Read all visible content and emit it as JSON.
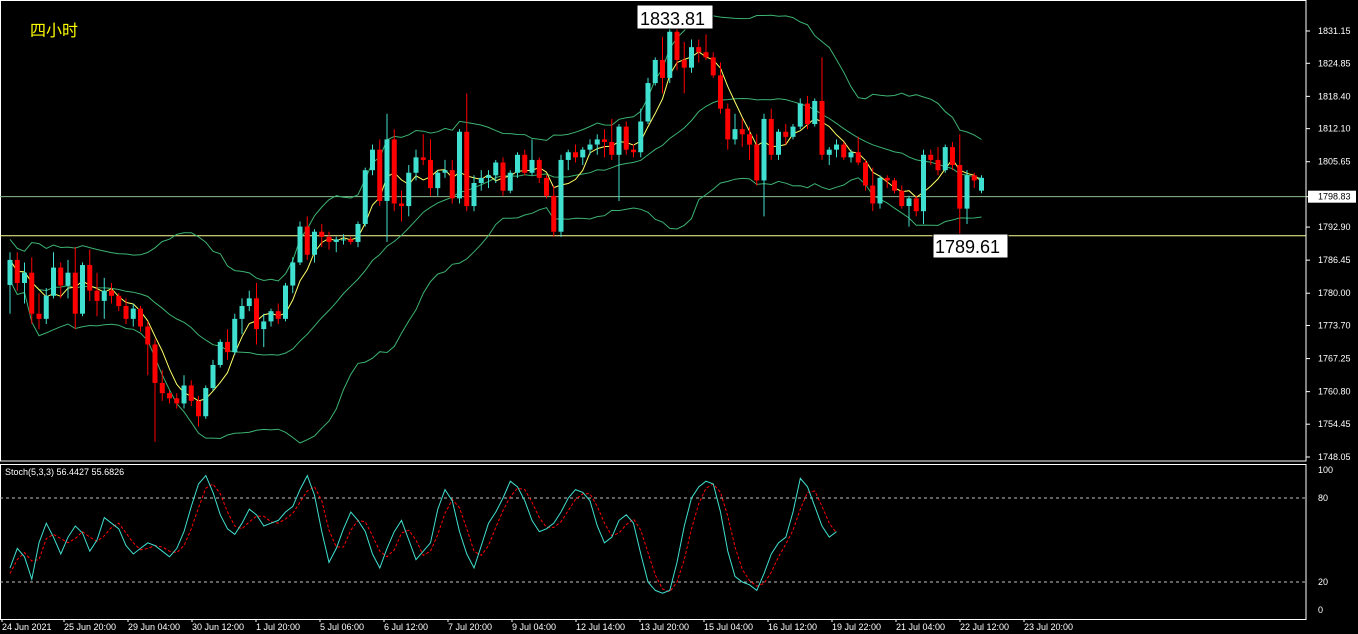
{
  "period_label": "四小时",
  "indicator_label": "Stoch(5,3,3) 56.4427 55.6826",
  "callouts": {
    "high": "1833.81",
    "low": "1789.61"
  },
  "current_price": "1798.83",
  "colors": {
    "background": "#000000",
    "bull": "#40e0d0",
    "bear": "#ff0000",
    "bands": "#3cb371",
    "ma": "#ffff66",
    "stoch_main": "#40e0d0",
    "stoch_signal": "#ff0000",
    "level_line": "#ffff99",
    "axis": "#ffffff"
  },
  "chart_data": {
    "type": "candlestick",
    "price_ticks": [
      "1831.15",
      "1824.85",
      "1818.40",
      "1812.10",
      "1805.65",
      "1798.83",
      "1792.90",
      "1786.45",
      "1780.00",
      "1773.70",
      "1767.25",
      "1760.80",
      "1754.45",
      "1748.05"
    ],
    "stoch_ticks": [
      "100",
      "80",
      "20",
      "0"
    ],
    "stoch_levels": [
      80,
      20
    ],
    "x_labels": [
      "24 Jun 2021",
      "25 Jun 20:00",
      "29 Jun 04:00",
      "30 Jun 12:00",
      "1 Jul 20:00",
      "5 Jul 06:00",
      "6 Jul 12:00",
      "7 Jul 20:00",
      "9 Jul 04:00",
      "12 Jul 14:00",
      "13 Jul 20:00",
      "15 Jul 04:00",
      "16 Jul 12:00",
      "19 Jul 22:00",
      "21 Jul 04:00",
      "22 Jul 12:00",
      "23 Jul 20:00"
    ],
    "horizontal_levels": [
      1798.83,
      1791.2
    ],
    "ohlc": [
      [
        1781.6,
        1788.0,
        1776.0,
        1786.5
      ],
      [
        1786.5,
        1788.0,
        1780.5,
        1782.0
      ],
      [
        1782.0,
        1786.0,
        1778.0,
        1784.0
      ],
      [
        1784.0,
        1787.0,
        1774.0,
        1776.0
      ],
      [
        1776.0,
        1780.0,
        1773.0,
        1775.0
      ],
      [
        1775.0,
        1781.0,
        1774.0,
        1779.5
      ],
      [
        1779.5,
        1788.0,
        1779.0,
        1785.0
      ],
      [
        1785.0,
        1786.0,
        1779.0,
        1781.5
      ],
      [
        1781.5,
        1786.5,
        1779.0,
        1784.0
      ],
      [
        1784.0,
        1789.0,
        1773.0,
        1776.0
      ],
      [
        1776.0,
        1786.0,
        1775.5,
        1785.5
      ],
      [
        1785.5,
        1788.5,
        1778.5,
        1780.5
      ],
      [
        1780.5,
        1784.0,
        1775.5,
        1778.5
      ],
      [
        1778.5,
        1783.0,
        1775.0,
        1780.5
      ],
      [
        1780.5,
        1782.0,
        1778.0,
        1779.5
      ],
      [
        1779.5,
        1780.0,
        1776.5,
        1777.5
      ],
      [
        1777.5,
        1779.0,
        1774.0,
        1775.0
      ],
      [
        1775.0,
        1778.0,
        1773.5,
        1777.0
      ],
      [
        1777.0,
        1777.5,
        1772.5,
        1773.5
      ],
      [
        1773.5,
        1774.5,
        1764.0,
        1770.0
      ],
      [
        1770.0,
        1771.0,
        1751.0,
        1762.5
      ],
      [
        1762.5,
        1765.0,
        1759.0,
        1760.5
      ],
      [
        1760.5,
        1761.0,
        1758.5,
        1759.5
      ],
      [
        1759.5,
        1760.5,
        1757.5,
        1758.5
      ],
      [
        1758.5,
        1764.0,
        1757.5,
        1762.0
      ],
      [
        1762.0,
        1763.0,
        1758.0,
        1759.0
      ],
      [
        1759.0,
        1760.0,
        1754.0,
        1756.0
      ],
      [
        1756.0,
        1762.0,
        1755.5,
        1761.5
      ],
      [
        1761.5,
        1767.0,
        1761.0,
        1766.0
      ],
      [
        1766.0,
        1771.0,
        1765.5,
        1770.5
      ],
      [
        1770.5,
        1773.0,
        1767.0,
        1768.5
      ],
      [
        1768.5,
        1776.0,
        1768.0,
        1775.0
      ],
      [
        1775.0,
        1779.0,
        1772.0,
        1777.5
      ],
      [
        1777.5,
        1780.5,
        1776.5,
        1779.0
      ],
      [
        1779.0,
        1782.0,
        1770.0,
        1773.0
      ],
      [
        1773.0,
        1776.0,
        1769.5,
        1774.5
      ],
      [
        1774.5,
        1777.0,
        1773.5,
        1776.5
      ],
      [
        1776.5,
        1778.0,
        1774.0,
        1775.0
      ],
      [
        1775.0,
        1782.0,
        1774.5,
        1781.5
      ],
      [
        1781.5,
        1787.0,
        1780.0,
        1786.0
      ],
      [
        1786.0,
        1794.0,
        1785.5,
        1793.0
      ],
      [
        1793.0,
        1795.0,
        1786.5,
        1787.5
      ],
      [
        1787.5,
        1792.5,
        1786.0,
        1792.0
      ],
      [
        1792.0,
        1793.5,
        1789.0,
        1791.0
      ],
      [
        1791.0,
        1792.0,
        1788.5,
        1790.0
      ],
      [
        1790.0,
        1791.0,
        1788.0,
        1790.5
      ],
      [
        1790.5,
        1791.5,
        1789.5,
        1790.5
      ],
      [
        1790.5,
        1791.0,
        1789.5,
        1790.0
      ],
      [
        1790.0,
        1794.0,
        1789.0,
        1793.5
      ],
      [
        1793.5,
        1804.5,
        1793.0,
        1804.0
      ],
      [
        1804.0,
        1809.0,
        1803.0,
        1808.0
      ],
      [
        1808.0,
        1810.0,
        1797.0,
        1798.0
      ],
      [
        1798.0,
        1815.0,
        1790.0,
        1810.0
      ],
      [
        1810.0,
        1812.0,
        1796.0,
        1797.5
      ],
      [
        1797.5,
        1800.0,
        1794.0,
        1797.0
      ],
      [
        1797.0,
        1805.0,
        1795.0,
        1803.5
      ],
      [
        1803.5,
        1808.0,
        1802.0,
        1806.5
      ],
      [
        1806.5,
        1811.0,
        1805.0,
        1806.0
      ],
      [
        1806.0,
        1810.0,
        1799.0,
        1800.5
      ],
      [
        1800.5,
        1804.0,
        1799.0,
        1803.5
      ],
      [
        1803.5,
        1806.0,
        1802.5,
        1804.0
      ],
      [
        1804.0,
        1806.0,
        1797.5,
        1798.5
      ],
      [
        1798.5,
        1812.0,
        1797.5,
        1811.5
      ],
      [
        1811.5,
        1819.0,
        1796.0,
        1797.0
      ],
      [
        1797.0,
        1803.0,
        1796.0,
        1801.5
      ],
      [
        1801.5,
        1804.0,
        1800.0,
        1802.5
      ],
      [
        1802.5,
        1804.0,
        1800.5,
        1803.0
      ],
      [
        1803.0,
        1806.0,
        1801.5,
        1805.5
      ],
      [
        1805.5,
        1806.5,
        1799.0,
        1800.0
      ],
      [
        1800.0,
        1804.0,
        1799.5,
        1803.5
      ],
      [
        1803.5,
        1807.5,
        1802.5,
        1807.0
      ],
      [
        1807.0,
        1808.0,
        1803.0,
        1803.5
      ],
      [
        1803.5,
        1810.0,
        1803.0,
        1806.0
      ],
      [
        1806.0,
        1806.5,
        1801.5,
        1802.5
      ],
      [
        1802.5,
        1803.0,
        1798.5,
        1799.0
      ],
      [
        1799.0,
        1801.0,
        1791.0,
        1792.0
      ],
      [
        1792.0,
        1807.0,
        1791.0,
        1806.0
      ],
      [
        1806.0,
        1808.0,
        1804.0,
        1807.5
      ],
      [
        1807.5,
        1809.0,
        1805.5,
        1806.5
      ],
      [
        1806.5,
        1808.5,
        1805.0,
        1808.0
      ],
      [
        1808.0,
        1810.0,
        1807.0,
        1809.0
      ],
      [
        1809.0,
        1811.0,
        1807.0,
        1810.0
      ],
      [
        1810.0,
        1812.0,
        1806.5,
        1809.5
      ],
      [
        1809.5,
        1814.0,
        1806.0,
        1807.0
      ],
      [
        1807.0,
        1813.0,
        1798.0,
        1812.5
      ],
      [
        1812.5,
        1813.5,
        1807.0,
        1808.0
      ],
      [
        1808.0,
        1809.0,
        1806.5,
        1807.5
      ],
      [
        1807.5,
        1816.0,
        1806.5,
        1813.5
      ],
      [
        1813.5,
        1822.0,
        1813.0,
        1821.0
      ],
      [
        1821.0,
        1826.0,
        1820.5,
        1825.5
      ],
      [
        1825.5,
        1830.0,
        1819.0,
        1822.0
      ],
      [
        1822.0,
        1833.81,
        1821.0,
        1831.0
      ],
      [
        1831.0,
        1833.0,
        1823.5,
        1825.5
      ],
      [
        1825.5,
        1829.0,
        1819.0,
        1824.0
      ],
      [
        1824.0,
        1829.5,
        1823.0,
        1828.0
      ],
      [
        1828.0,
        1829.5,
        1825.0,
        1827.0
      ],
      [
        1827.0,
        1830.5,
        1825.5,
        1826.0
      ],
      [
        1826.0,
        1827.0,
        1822.0,
        1822.5
      ],
      [
        1822.5,
        1825.0,
        1815.0,
        1816.0
      ],
      [
        1816.0,
        1817.0,
        1808.0,
        1810.0
      ],
      [
        1810.0,
        1815.0,
        1809.0,
        1812.0
      ],
      [
        1812.0,
        1814.0,
        1808.5,
        1811.0
      ],
      [
        1811.0,
        1812.5,
        1806.0,
        1809.0
      ],
      [
        1809.0,
        1811.0,
        1801.0,
        1802.0
      ],
      [
        1802.0,
        1815.0,
        1795.0,
        1814.0
      ],
      [
        1814.0,
        1816.0,
        1806.0,
        1807.0
      ],
      [
        1807.0,
        1812.0,
        1806.0,
        1811.5
      ],
      [
        1811.5,
        1813.0,
        1809.0,
        1810.5
      ],
      [
        1810.5,
        1813.0,
        1810.0,
        1812.5
      ],
      [
        1812.5,
        1818.0,
        1812.0,
        1817.0
      ],
      [
        1817.0,
        1818.5,
        1812.0,
        1813.0
      ],
      [
        1813.0,
        1818.0,
        1812.5,
        1817.5
      ],
      [
        1817.5,
        1826.0,
        1806.0,
        1807.0
      ],
      [
        1807.0,
        1808.5,
        1805.0,
        1808.0
      ],
      [
        1808.0,
        1810.0,
        1806.5,
        1809.0
      ],
      [
        1809.0,
        1809.5,
        1806.0,
        1806.5
      ],
      [
        1806.5,
        1808.0,
        1805.5,
        1807.5
      ],
      [
        1807.5,
        1810.5,
        1805.0,
        1805.5
      ],
      [
        1805.5,
        1806.0,
        1800.0,
        1801.0
      ],
      [
        1801.0,
        1804.5,
        1796.0,
        1797.5
      ],
      [
        1797.5,
        1803.0,
        1796.5,
        1802.5
      ],
      [
        1802.5,
        1803.0,
        1800.5,
        1802.0
      ],
      [
        1802.0,
        1802.5,
        1799.5,
        1800.0
      ],
      [
        1800.0,
        1801.0,
        1796.5,
        1797.0
      ],
      [
        1797.0,
        1799.0,
        1793.0,
        1798.5
      ],
      [
        1798.5,
        1799.0,
        1795.0,
        1796.0
      ],
      [
        1796.0,
        1808.0,
        1793.5,
        1807.0
      ],
      [
        1807.0,
        1808.0,
        1805.0,
        1806.0
      ],
      [
        1806.0,
        1808.5,
        1803.0,
        1804.0
      ],
      [
        1804.0,
        1809.0,
        1803.5,
        1808.5
      ],
      [
        1808.5,
        1809.5,
        1804.0,
        1805.0
      ],
      [
        1805.0,
        1811.0,
        1789.61,
        1796.5
      ],
      [
        1796.5,
        1804.0,
        1793.5,
        1803.0
      ],
      [
        1803.0,
        1803.5,
        1800.5,
        1802.0
      ],
      [
        1800.0,
        1803.0,
        1799.5,
        1802.5
      ]
    ],
    "stoch_main": [
      30,
      44,
      38,
      22,
      48,
      62,
      52,
      40,
      52,
      60,
      55,
      42,
      50,
      66,
      62,
      58,
      46,
      40,
      44,
      48,
      46,
      42,
      38,
      44,
      56,
      74,
      90,
      96,
      84,
      68,
      58,
      54,
      62,
      72,
      68,
      60,
      62,
      64,
      70,
      74,
      86,
      96,
      82,
      56,
      34,
      44,
      58,
      70,
      64,
      56,
      40,
      30,
      44,
      56,
      64,
      50,
      36,
      42,
      48,
      72,
      86,
      78,
      56,
      40,
      30,
      46,
      62,
      70,
      80,
      92,
      88,
      78,
      64,
      56,
      58,
      62,
      70,
      80,
      86,
      84,
      78,
      60,
      48,
      52,
      64,
      68,
      62,
      40,
      20,
      14,
      12,
      14,
      34,
      60,
      80,
      88,
      92,
      90,
      70,
      42,
      24,
      20,
      18,
      14,
      26,
      40,
      48,
      52,
      70,
      94,
      88,
      74,
      60,
      52,
      56
    ],
    "stoch_signal": [
      26,
      36,
      41,
      35,
      36,
      51,
      54,
      51,
      48,
      51,
      56,
      52,
      49,
      53,
      59,
      62,
      55,
      48,
      43,
      44,
      46,
      45,
      42,
      41,
      46,
      58,
      73,
      87,
      90,
      83,
      70,
      60,
      58,
      63,
      67,
      67,
      63,
      62,
      65,
      69,
      77,
      85,
      88,
      78,
      57,
      45,
      45,
      57,
      64,
      63,
      53,
      42,
      38,
      43,
      55,
      57,
      50,
      39,
      42,
      54,
      69,
      79,
      73,
      58,
      42,
      39,
      46,
      59,
      71,
      81,
      87,
      86,
      77,
      66,
      59,
      59,
      63,
      71,
      79,
      83,
      83,
      74,
      62,
      53,
      55,
      61,
      65,
      57,
      41,
      25,
      15,
      13,
      20,
      36,
      58,
      76,
      87,
      90,
      84,
      67,
      45,
      29,
      21,
      17,
      19,
      27,
      38,
      47,
      57,
      72,
      84,
      85,
      74,
      62,
      55
    ]
  }
}
